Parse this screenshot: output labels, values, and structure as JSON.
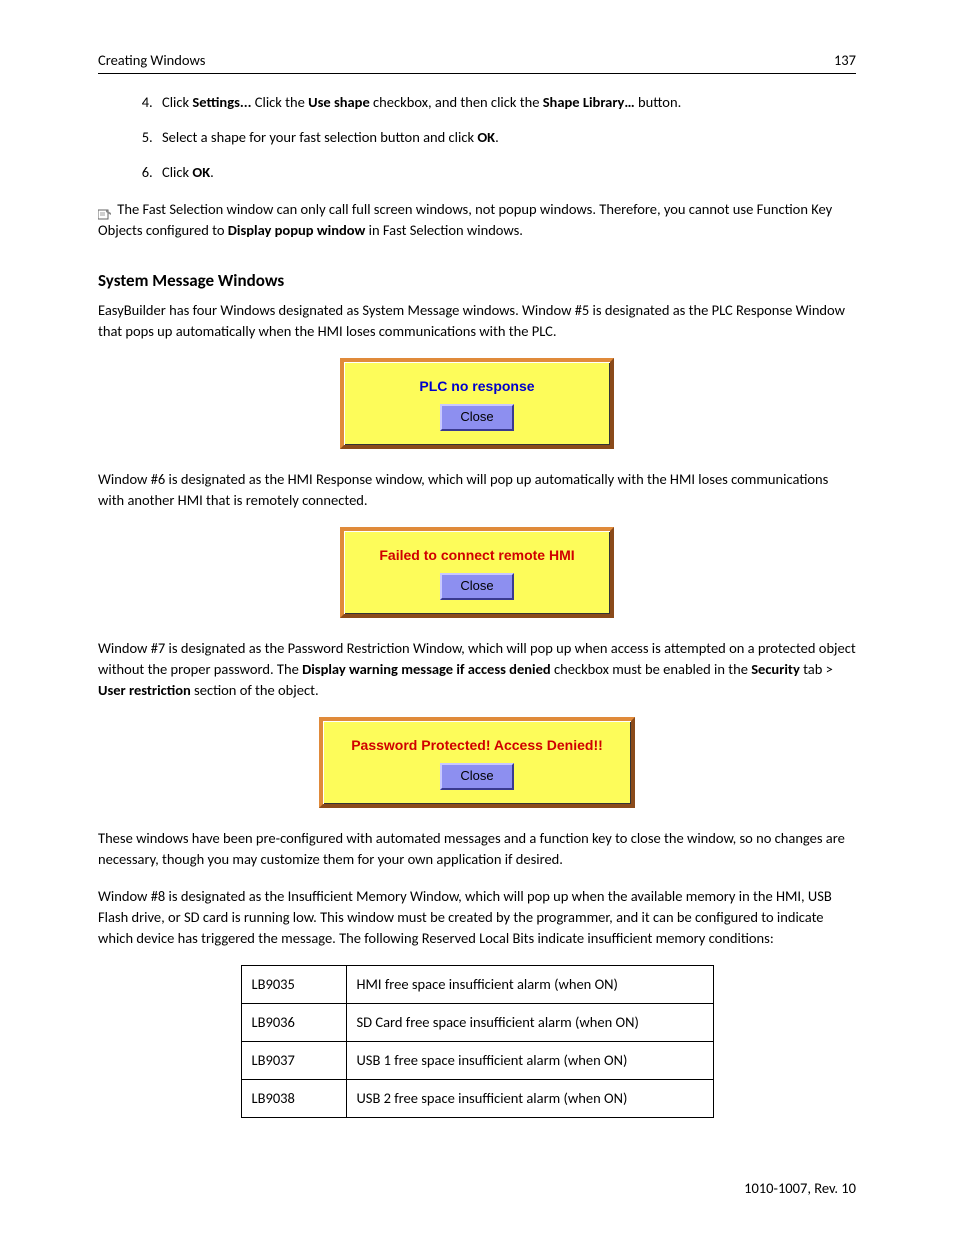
{
  "header": {
    "title": "Creating Windows",
    "page": "137"
  },
  "steps": {
    "s4_pre": "Click ",
    "s4_b1": "Settings...",
    "s4_mid1": " Click the ",
    "s4_b2": "Use shape",
    "s4_mid2": " checkbox, and then click the ",
    "s4_b3": "Shape Library…",
    "s4_post": " button.",
    "s5_pre": "Select a shape for your fast selection button and click ",
    "s5_b1": "OK",
    "s5_post": ".",
    "s6_pre": "Click ",
    "s6_b1": "OK",
    "s6_post": "."
  },
  "note": {
    "pre": " The Fast Selection window can only call full screen windows, not popup windows. Therefore, you cannot use Function Key Objects configured to ",
    "b1": "Display popup window",
    "post": " in Fast Selection windows."
  },
  "section_title": "System Message Windows",
  "p1": "EasyBuilder has four Windows designated as System Message windows. Window #5 is designated as the PLC Response Window that pops up automatically when the HMI loses communications with the PLC.",
  "dlg1": {
    "msg": "PLC no response",
    "close": "Close"
  },
  "p2": "Window #6 is designated as the HMI Response window, which will pop up automatically with the HMI loses communications with another HMI that is remotely connected.",
  "dlg2": {
    "msg": "Failed to connect remote HMI",
    "close": "Close"
  },
  "p3": {
    "pre": "Window #7 is designated as the Password Restriction Window, which will pop up when access is attempted on a protected object without the proper password. The ",
    "b1": "Display warning message if access denied",
    "mid1": " checkbox must be enabled in the ",
    "b2": "Security",
    "mid2": " tab > ",
    "b3": "User restriction",
    "post": " section of the object."
  },
  "dlg3": {
    "msg": "Password Protected! Access Denied!!",
    "close": "Close"
  },
  "p4": "These windows have been pre-configured with automated messages and a function key to close the window, so no changes are necessary, though you may customize them for your own application if desired.",
  "p5": "Window #8 is designated as the Insufficient Memory Window, which will pop up when the available memory in the HMI, USB Flash drive, or SD card is running low. This window must be created by the programmer, and it can be configured to indicate which device has triggered the message. The following Reserved Local Bits indicate insufficient memory conditions:",
  "table": {
    "rows": [
      {
        "code": "LB9035",
        "desc": "HMI free space insufficient alarm (when ON)"
      },
      {
        "code": "LB9036",
        "desc": "SD Card free space insufficient alarm (when ON)"
      },
      {
        "code": "LB9037",
        "desc": "USB 1 free space insufficient alarm (when ON)"
      },
      {
        "code": "LB9038",
        "desc": "USB 2 free space insufficient alarm (when ON)"
      }
    ]
  },
  "footer": "1010-1007, Rev. 10"
}
